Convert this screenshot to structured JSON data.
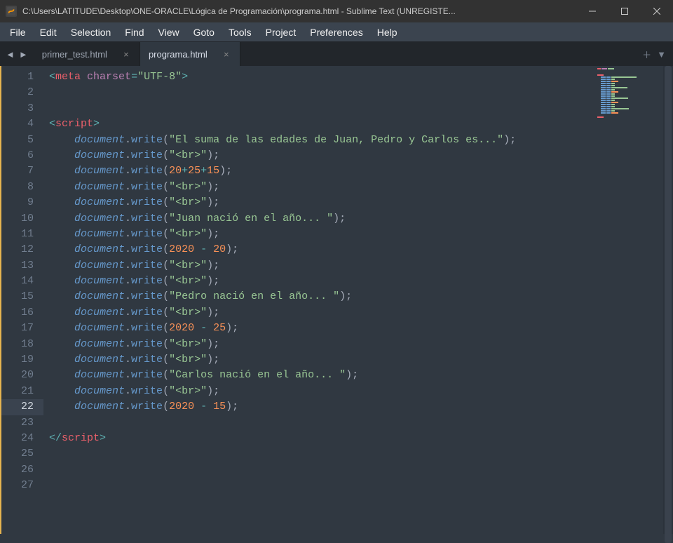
{
  "window": {
    "title": "C:\\Users\\LATITUDE\\Desktop\\ONE-ORACLE\\Lógica de Programación\\programa.html - Sublime Text (UNREGISTE..."
  },
  "menu": [
    "File",
    "Edit",
    "Selection",
    "Find",
    "View",
    "Goto",
    "Tools",
    "Project",
    "Preferences",
    "Help"
  ],
  "tabs": [
    {
      "label": "primer_test.html",
      "active": false
    },
    {
      "label": "programa.html",
      "active": true
    }
  ],
  "activeLine": 22,
  "lines": [
    {
      "n": 1,
      "indent": 0,
      "t": "meta"
    },
    {
      "n": 2,
      "indent": 0,
      "t": "blank"
    },
    {
      "n": 3,
      "indent": 0,
      "t": "blank"
    },
    {
      "n": 4,
      "indent": 0,
      "t": "open-script"
    },
    {
      "n": 5,
      "indent": 1,
      "t": "dw-str",
      "s": "\"El suma de las edades de Juan, Pedro y Carlos es...\""
    },
    {
      "n": 6,
      "indent": 1,
      "t": "dw-str",
      "s": "\"<br>\""
    },
    {
      "n": 7,
      "indent": 1,
      "t": "dw-sum",
      "a": "20",
      "b": "25",
      "c": "15"
    },
    {
      "n": 8,
      "indent": 1,
      "t": "dw-str",
      "s": "\"<br>\""
    },
    {
      "n": 9,
      "indent": 1,
      "t": "dw-str",
      "s": "\"<br>\""
    },
    {
      "n": 10,
      "indent": 1,
      "t": "dw-str",
      "s": "\"Juan nació en el año... \""
    },
    {
      "n": 11,
      "indent": 1,
      "t": "dw-str",
      "s": "\"<br>\""
    },
    {
      "n": 12,
      "indent": 1,
      "t": "dw-sub",
      "a": "2020",
      "b": "20"
    },
    {
      "n": 13,
      "indent": 1,
      "t": "dw-str",
      "s": "\"<br>\""
    },
    {
      "n": 14,
      "indent": 1,
      "t": "dw-str",
      "s": "\"<br>\""
    },
    {
      "n": 15,
      "indent": 1,
      "t": "dw-str",
      "s": "\"Pedro nació en el año... \""
    },
    {
      "n": 16,
      "indent": 1,
      "t": "dw-str",
      "s": "\"<br>\""
    },
    {
      "n": 17,
      "indent": 1,
      "t": "dw-sub",
      "a": "2020",
      "b": "25"
    },
    {
      "n": 18,
      "indent": 1,
      "t": "dw-str",
      "s": "\"<br>\""
    },
    {
      "n": 19,
      "indent": 1,
      "t": "dw-str",
      "s": "\"<br>\""
    },
    {
      "n": 20,
      "indent": 1,
      "t": "dw-str",
      "s": "\"Carlos nació en el año... \""
    },
    {
      "n": 21,
      "indent": 1,
      "t": "dw-str",
      "s": "\"<br>\""
    },
    {
      "n": 22,
      "indent": 1,
      "t": "dw-sub",
      "a": "2020",
      "b": "15"
    },
    {
      "n": 23,
      "indent": 0,
      "t": "blank"
    },
    {
      "n": 24,
      "indent": 0,
      "t": "close-script"
    },
    {
      "n": 25,
      "indent": 0,
      "t": "blank"
    },
    {
      "n": 26,
      "indent": 0,
      "t": "blank"
    },
    {
      "n": 27,
      "indent": 0,
      "t": "blank"
    }
  ],
  "tokens": {
    "meta_tag": "meta",
    "meta_attr": "charset",
    "meta_val": "\"UTF-8\"",
    "script_tag": "script",
    "doc": "document",
    "write": "write",
    "plus": "+",
    "minus": "-"
  }
}
